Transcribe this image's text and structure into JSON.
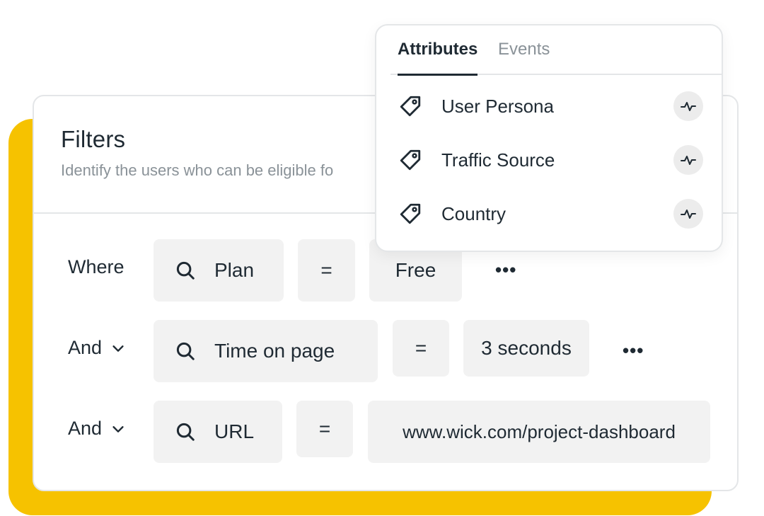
{
  "filters": {
    "title": "Filters",
    "subtitle": "Identify the users who can be eligible fo"
  },
  "rows": [
    {
      "connector": "Where",
      "field": "Plan",
      "operator": "=",
      "value": "Free",
      "more": "•••"
    },
    {
      "connector": "And",
      "field": "Time on page",
      "operator": "=",
      "value": "3 seconds",
      "more": "•••"
    },
    {
      "connector": "And",
      "field": "URL",
      "operator": "=",
      "value": "www.wick.com/project-dashboard"
    }
  ],
  "dropdown": {
    "tabs": [
      {
        "label": "Attributes",
        "active": true
      },
      {
        "label": "Events",
        "active": false
      }
    ],
    "options": [
      {
        "label": "User Persona",
        "icon": "tag-icon"
      },
      {
        "label": "Traffic Source",
        "icon": "tag-icon"
      },
      {
        "label": "Country",
        "icon": "tag-icon"
      }
    ]
  },
  "colors": {
    "accent": "#f6c200",
    "text": "#1f2a33",
    "muted": "#8a9298",
    "pill": "#f2f2f2"
  }
}
